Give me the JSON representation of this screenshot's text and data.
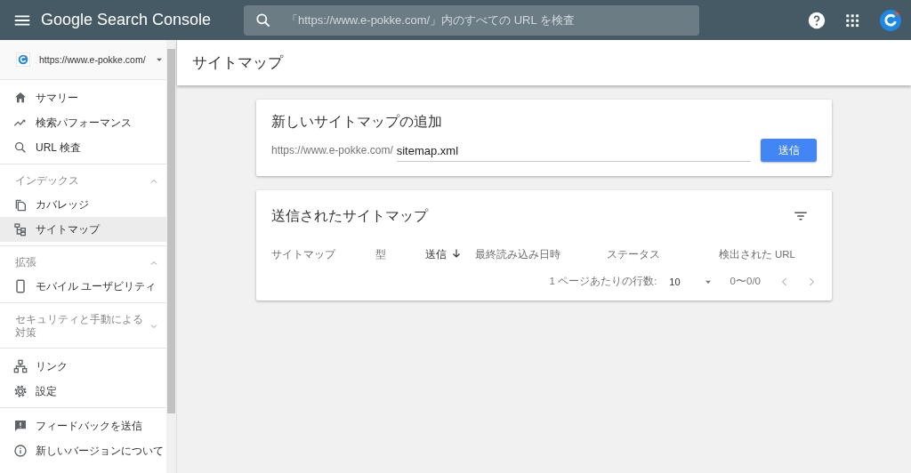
{
  "header": {
    "app_title": "Google Search Console",
    "search": {
      "placeholder": "「https://www.e-pokke.com/」内のすべての URL を検査"
    }
  },
  "property": {
    "url": "https://www.e-pokke.com/"
  },
  "sidebar": {
    "sections": [
      {
        "items": [
          {
            "label": "サマリー",
            "selected": false
          },
          {
            "label": "検索パフォーマンス",
            "selected": false
          },
          {
            "label": "URL 検査",
            "selected": false
          }
        ]
      },
      {
        "heading": "インデックス",
        "expanded": true,
        "items": [
          {
            "label": "カバレッジ",
            "selected": false
          },
          {
            "label": "サイトマップ",
            "selected": true
          }
        ]
      },
      {
        "heading": "拡張",
        "expanded": true,
        "items": [
          {
            "label": "モバイル ユーザビリティ",
            "selected": false
          }
        ]
      },
      {
        "heading": "セキュリティと手動による対策",
        "expanded": false
      },
      {
        "items": [
          {
            "label": "リンク",
            "selected": false
          },
          {
            "label": "設定",
            "selected": false
          }
        ]
      },
      {
        "items": [
          {
            "label": "フィードバックを送信",
            "selected": false
          },
          {
            "label": "新しいバージョンについて",
            "selected": false
          }
        ]
      }
    ]
  },
  "page_title": "サイトマップ",
  "add_card": {
    "title": "新しいサイトマップの追加",
    "prefix": "https://www.e-pokke.com/",
    "value": "sitemap.xml",
    "button": "送信"
  },
  "submitted_card": {
    "title": "送信されたサイトマップ",
    "columns": [
      {
        "label": "サイトマップ",
        "sorted": false
      },
      {
        "label": "型",
        "sorted": false
      },
      {
        "label": "送信",
        "sorted": true
      },
      {
        "label": "最終読み込み日時",
        "sorted": false
      },
      {
        "label": "ステータス",
        "sorted": false
      },
      {
        "label": "検出された URL",
        "sorted": false
      }
    ],
    "pagination": {
      "rows_label": "1 ページあたりの行数:",
      "rows_value": "10",
      "range": "0〜0/0"
    }
  }
}
